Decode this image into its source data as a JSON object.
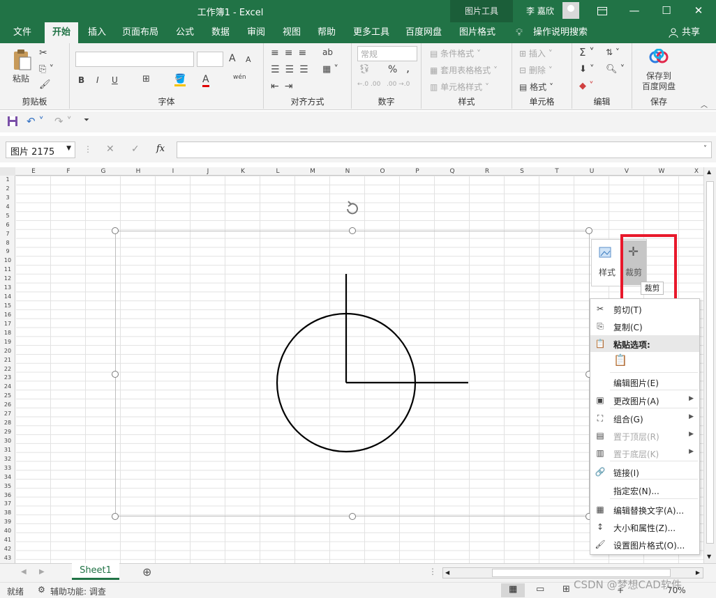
{
  "window": {
    "title": "工作簿1  -  Excel",
    "picture_tools": "图片工具",
    "user": "李 嘉欣",
    "ribbon_display_icon": "ribbon-display-icon",
    "minimize": "—",
    "maximize": "☐",
    "close": "✕"
  },
  "tabs": [
    {
      "label": "文件",
      "active": false
    },
    {
      "label": "开始",
      "active": true
    },
    {
      "label": "插入",
      "active": false
    },
    {
      "label": "页面布局",
      "active": false
    },
    {
      "label": "公式",
      "active": false
    },
    {
      "label": "数据",
      "active": false
    },
    {
      "label": "审阅",
      "active": false
    },
    {
      "label": "视图",
      "active": false
    },
    {
      "label": "帮助",
      "active": false
    },
    {
      "label": "更多工具",
      "active": false
    },
    {
      "label": "百度网盘",
      "active": false
    },
    {
      "label": "图片格式",
      "active": false
    }
  ],
  "tell_me": "操作说明搜索",
  "share": "共享",
  "ribbon": {
    "clipboard": {
      "paste": "粘贴",
      "label": "剪贴板"
    },
    "font": {
      "label": "字体",
      "bold": "B",
      "italic": "I",
      "underline": "U",
      "grow": "A",
      "shrink": "A",
      "font_color": "A",
      "phonetic": "wén"
    },
    "alignment": {
      "label": "对齐方式"
    },
    "number": {
      "label": "数字",
      "format": "常规",
      "percent": "%",
      "comma": ",",
      "inc": "←.0 .00",
      "dec": ".00 →.0"
    },
    "styles": {
      "label": "样式",
      "conditional": "条件格式",
      "table": "套用表格格式",
      "cell": "单元格样式"
    },
    "cells": {
      "label": "单元格",
      "insert": "插入",
      "delete": "删除",
      "format": "格式"
    },
    "editing": {
      "label": "编辑"
    },
    "save": {
      "label": "保存",
      "button": "保存到\n百度网盘"
    }
  },
  "formula_bar": {
    "name_box": "图片 2175",
    "fx": "fx",
    "value": ""
  },
  "columns": [
    "E",
    "F",
    "G",
    "H",
    "I",
    "J",
    "K",
    "L",
    "M",
    "N",
    "O",
    "P",
    "Q",
    "R",
    "S",
    "T",
    "U",
    "V",
    "W",
    "X"
  ],
  "rows": [
    "1",
    "2",
    "3",
    "4",
    "5",
    "6",
    "7",
    "8",
    "9",
    "10",
    "11",
    "12",
    "13",
    "14",
    "15",
    "16",
    "17",
    "18",
    "19",
    "20",
    "21",
    "22",
    "23",
    "24",
    "25",
    "26",
    "27",
    "28",
    "29",
    "30",
    "31",
    "32",
    "33",
    "34",
    "35",
    "36",
    "37",
    "38",
    "39",
    "40",
    "41",
    "42",
    "43"
  ],
  "mini_toolbar": {
    "style": "样式",
    "crop": "裁剪",
    "tooltip": "裁剪"
  },
  "context_menu": [
    {
      "label": "剪切(T)",
      "icon": "scissors-icon",
      "glyph": "✂",
      "disabled": false,
      "submenu": false
    },
    {
      "label": "复制(C)",
      "icon": "copy-icon",
      "glyph": "⎘",
      "disabled": false,
      "submenu": false
    },
    {
      "label": "粘贴选项:",
      "icon": "paste-icon",
      "glyph": "📋",
      "disabled": false,
      "submenu": false,
      "header": true
    },
    {
      "label": "",
      "icon": "paste-option-icon",
      "glyph": "📋",
      "disabled": false,
      "submenu": false,
      "paste_option": true
    },
    {
      "label": "编辑图片(E)",
      "icon": "",
      "glyph": "",
      "disabled": false,
      "submenu": false
    },
    {
      "label": "更改图片(A)",
      "icon": "change-picture-icon",
      "glyph": "▣",
      "disabled": false,
      "submenu": true
    },
    {
      "label": "组合(G)",
      "icon": "group-icon",
      "glyph": "⛶",
      "disabled": false,
      "submenu": true
    },
    {
      "label": "置于顶层(R)",
      "icon": "bring-front-icon",
      "glyph": "▤",
      "disabled": true,
      "submenu": true
    },
    {
      "label": "置于底层(K)",
      "icon": "send-back-icon",
      "glyph": "▥",
      "disabled": true,
      "submenu": true
    },
    {
      "label": "链接(I)",
      "icon": "link-icon",
      "glyph": "🔗",
      "disabled": false,
      "submenu": false
    },
    {
      "label": "指定宏(N)...",
      "icon": "",
      "glyph": "",
      "disabled": false,
      "submenu": false
    },
    {
      "label": "编辑替换文字(A)...",
      "icon": "alt-text-icon",
      "glyph": "▦",
      "disabled": false,
      "submenu": false
    },
    {
      "label": "大小和属性(Z)...",
      "icon": "size-icon",
      "glyph": "↕",
      "disabled": false,
      "submenu": false
    },
    {
      "label": "设置图片格式(O)...",
      "icon": "format-picture-icon",
      "glyph": "🖌",
      "disabled": false,
      "submenu": false
    }
  ],
  "sheet_tabs": [
    {
      "label": "Sheet1",
      "active": true
    }
  ],
  "status": {
    "ready": "就绪",
    "accessibility": "辅助功能: 调查",
    "zoom": "70%",
    "watermark": "CSDN @梦想CAD软件"
  },
  "colors": {
    "excel_green": "#217346",
    "highlight_red": "#e8182b"
  }
}
